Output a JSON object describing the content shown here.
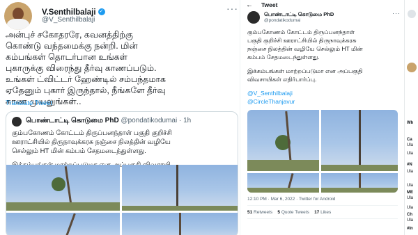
{
  "left": {
    "author": {
      "name": "V.Senthilbalaji",
      "handle": "@V_Senthilbalaji"
    },
    "menu": "···",
    "text_lines": [
      "அன்புச் சகோதரரே, கவனத்திற்கு",
      "கொண்டு வந்தமைக்கு நன்றி. மின்",
      "கம்பங்கள் தொடர்பான உங்கள்",
      "புகாருக்கு விரைந்து தீர்வு காணப்படும்.",
      "உங்கள் ட்விட்டர் ஹேண்டில் சம்பந்தமாக",
      "ஏதேனும் புகார் இருந்தால், நீங்களே தீர்வு",
      "காண முயலுங்கள்.."
    ],
    "translate": "Translate Tweet",
    "quote": {
      "name": "பொண்டாட்டி கொடுமை PhD",
      "handle": "@pondatikodumai",
      "time": "· 1h",
      "lines": [
        "கும்பகோணம் கோட்டம் திருப்பனந்தாள் பகுதி குறிச்சி",
        "ஊராட்சியில் திருநாவுக்கரசு நஞ்சை நிலத்தின் வழியே",
        "செல்லும் HT மின் கம்பம் சேதமடைந்துள்ளது.",
        "இக்கம்பங்கள் மாற்றப்படுமா என அப்பகுதி விவசாயி..."
      ]
    }
  },
  "right": {
    "header": "Tweet",
    "back_icon": "arrow-left-icon",
    "author": {
      "name": "பொண்டாட்டி கொடுமை PhD",
      "handle": "@pondatikodumai"
    },
    "text_lines": [
      "கும்பகோணம் கோட்டம் திருப்பனந்தாள்",
      "பகுதி குறிச்சி ஊராட்சியில் திருநாவுக்கரசு",
      "நஞ்சை நிலத்தின் வழியே செல்லும் HT மின்",
      "கம்பம் சேதமடைந்துள்ளது."
    ],
    "text2_lines": [
      "இக்கம்பங்கள் மாற்றப்படுமா என அப்பகுதி",
      "விவசாயிகள் எதிர்பார்ப்பு."
    ],
    "mentions": [
      "@V_Senthilbalaji",
      "@CircleThanjavur"
    ],
    "timestamp": "12:10 PM · Mar 6, 2022 · Twitter for Android",
    "stats": [
      {
        "count": "51",
        "label": "Retweets"
      },
      {
        "count": "5",
        "label": "Quote Tweets"
      },
      {
        "count": "17",
        "label": "Likes"
      }
    ]
  },
  "strip": {
    "items": [
      "Wh",
      "Ca",
      "Ula",
      "Ula",
      "#N",
      "Ula",
      "Ula",
      "ME",
      "Ula",
      "Ula",
      "Ch",
      "Ula",
      "#In"
    ]
  }
}
